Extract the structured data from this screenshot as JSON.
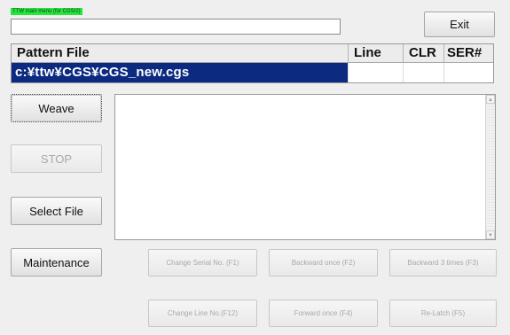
{
  "window": {
    "title": "TTW main menu (for CGS/2)"
  },
  "top_field": {
    "value": ""
  },
  "toolbar": {
    "exit_label": "Exit"
  },
  "pattern_table": {
    "columns": [
      "Pattern File",
      "Line",
      "CLR",
      "SER#"
    ],
    "rows": [
      [
        "c:¥ttw¥CGS¥CGS_new.cgs",
        "",
        "",
        ""
      ]
    ]
  },
  "left_buttons": {
    "weave_label": "Weave",
    "stop_label": "STOP",
    "select_file_label": "Select File",
    "maintenance_label": "Maintenance"
  },
  "log": {
    "text": ""
  },
  "action_buttons": {
    "change_serial": "Change Serial No. (F1)",
    "backward_once": "Backward once (F2)",
    "backward_three": "Backward 3 times (F3)",
    "change_line": "Change Line No.(F12)",
    "forward_once": "Forward once (F4)",
    "relatch": "Re-Latch (F5)"
  },
  "colors": {
    "selection": "#0b2a80",
    "title_highlight": "#22e83a"
  },
  "icons": {
    "scroll_up": "scroll-up-arrow-icon",
    "scroll_down": "scroll-down-arrow-icon"
  }
}
